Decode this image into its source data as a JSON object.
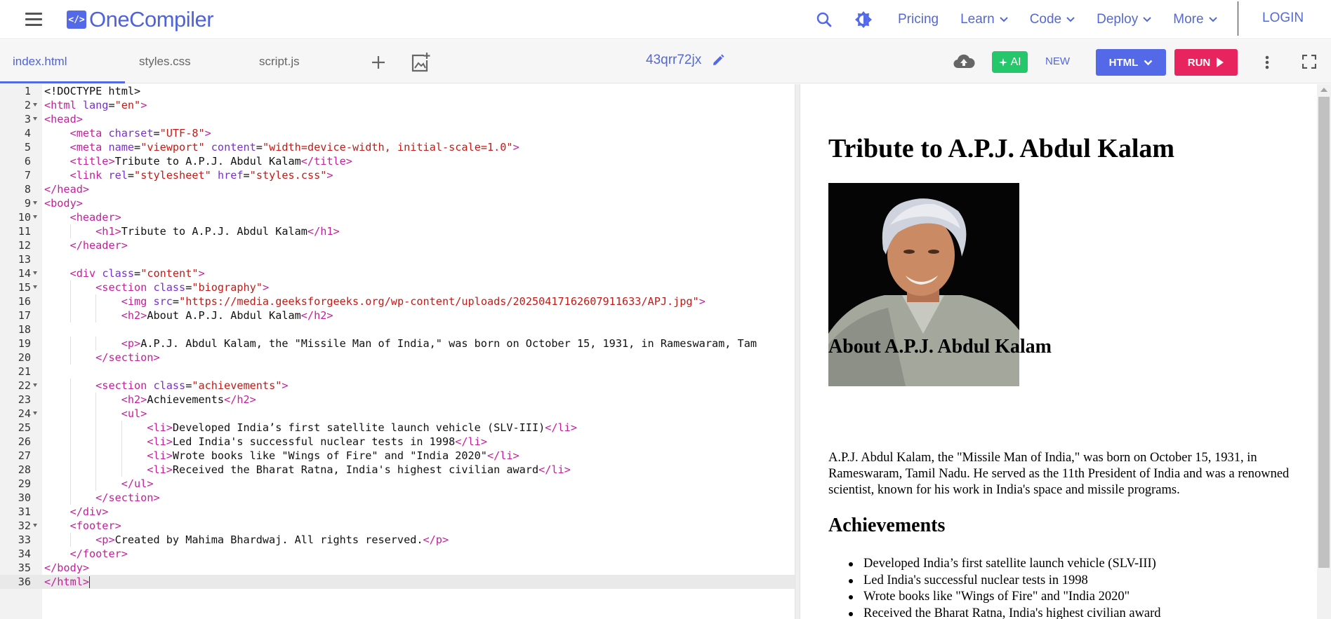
{
  "nav": {
    "logo_symbol": "</>",
    "logo_text": "OneCompiler",
    "links": [
      "Pricing",
      "Learn",
      "Code",
      "Deploy",
      "More"
    ],
    "login": "LOGIN",
    "icons": [
      "menu-icon",
      "search-icon",
      "theme-toggle-icon",
      "chevron-down-icon"
    ]
  },
  "tabs": [
    "index.html",
    "styles.css",
    "script.js"
  ],
  "toolbar": {
    "project_name": "43qrr72jx",
    "ai_label": "AI",
    "new_label": "NEW",
    "language": "HTML",
    "run_label": "RUN",
    "icons": [
      "add-file-icon",
      "add-image-icon",
      "edit-icon",
      "cloud-upload-icon",
      "more-vert-icon",
      "fullscreen-icon"
    ]
  },
  "editor": {
    "active_line": 36,
    "lines": [
      "<!DOCTYPE html>",
      "<html lang=\"en\">",
      "<head>",
      "    <meta charset=\"UTF-8\">",
      "    <meta name=\"viewport\" content=\"width=device-width, initial-scale=1.0\">",
      "    <title>Tribute to A.P.J. Abdul Kalam</title>",
      "    <link rel=\"stylesheet\" href=\"styles.css\">",
      "</head>",
      "<body>",
      "    <header>",
      "        <h1>Tribute to A.P.J. Abdul Kalam</h1>",
      "    </header>",
      "",
      "    <div class=\"content\">",
      "        <section class=\"biography\">",
      "            <img src=\"https://media.geeksforgeeks.org/wp-content/uploads/20250417162607911633/APJ.jpg\">",
      "            <h2>About A.P.J. Abdul Kalam</h2>",
      "",
      "            <p>A.P.J. Abdul Kalam, the \"Missile Man of India,\" was born on October 15, 1931, in Rameswaram, Tam",
      "        </section>",
      "",
      "        <section class=\"achievements\">",
      "            <h2>Achievements</h2>",
      "            <ul>",
      "                <li>Developed India’s first satellite launch vehicle (SLV-III)</li>",
      "                <li>Led India's successful nuclear tests in 1998</li>",
      "                <li>Wrote books like \"Wings of Fire\" and \"India 2020\"</li>",
      "                <li>Received the Bharat Ratna, India's highest civilian award</li>",
      "            </ul>",
      "        </section>",
      "    </div>",
      "    <footer>",
      "        <p>Created by Mahima Bhardwaj. All rights reserved.</p>",
      "    </footer>",
      "</body>",
      "</html>"
    ],
    "foldable_lines": [
      2,
      3,
      9,
      10,
      14,
      15,
      22,
      24,
      32
    ]
  },
  "preview": {
    "title": "Tribute to A.P.J. Abdul Kalam",
    "about_heading": "About A.P.J. Abdul Kalam",
    "about_text": "A.P.J. Abdul Kalam, the \"Missile Man of India,\" was born on October 15, 1931, in Rameswaram, Tamil Nadu. He served as the 11th President of India and was a renowned scientist, known for his work in India's space and missile programs.",
    "achievements_heading": "Achievements",
    "achievements": [
      "Developed India’s first satellite launch vehicle (SLV-III)",
      "Led India's successful nuclear tests in 1998",
      "Wrote books like \"Wings of Fire\" and \"India 2020\"",
      "Received the Bharat Ratna, India's highest civilian award"
    ]
  },
  "colors": {
    "brand": "#5469e7",
    "ai": "#26c66b",
    "run": "#e8245f",
    "tag": "#c31f9a",
    "attr": "#7a2fd0",
    "string": "#c41a16"
  }
}
